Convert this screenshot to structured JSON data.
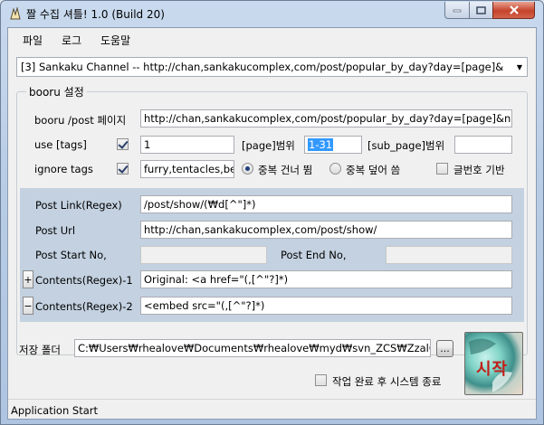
{
  "window": {
    "title": "짤 수집 셔틀! 1.0 (Build 20)"
  },
  "menu": [
    "파일",
    "로그",
    "도움말"
  ],
  "channel_select": {
    "value": "[3] Sankaku Channel -- http://chan,sankakucomplex,com/post/popular_by_day?day=[page]&"
  },
  "booru": {
    "group_label": "booru 설정",
    "post_page_label": "booru /post 페이지",
    "post_page_value": "http://chan,sankakucomplex,com/post/popular_by_day?day=[page]&n",
    "use_tags_label": "use [tags]",
    "use_tags_checked": true,
    "tags_value": "1",
    "page_range_label": "[page]범위",
    "page_range_value": "1-31",
    "sub_page_label": "[sub_page]범위",
    "sub_page_value": "",
    "ignore_tags_label": "ignore tags",
    "ignore_tags_checked": true,
    "ignore_tags_value": "furry,tentacles,be",
    "radio_skip_label": "중복 건너 뜀",
    "radio_overwrite_label": "중복 덮어 씀",
    "radio_selected": "skip",
    "by_post_number_label": "글번호 기반",
    "by_post_number_checked": false
  },
  "regex": {
    "post_link_label": "Post Link(Regex)",
    "post_link_value": "/post/show/(₩d[^\"]*)",
    "post_url_label": "Post Url",
    "post_url_value": "http://chan,sankakucomplex,com/post/show/",
    "post_start_label": "Post Start No,",
    "post_start_value": "",
    "post_end_label": "Post End No,",
    "post_end_value": "",
    "contents1_button": "+",
    "contents1_label": "Contents(Regex)-1",
    "contents1_value": "Original: <a href=\"(,[^\"?]*)",
    "contents2_button": "−",
    "contents2_label": "Contents(Regex)-2",
    "contents2_value": "<embed src=\"(,[^\"?]*)"
  },
  "save": {
    "label": "저장 폴더",
    "path": "C:₩Users₩rhealove₩Documents₩rhealove₩myd₩svn_ZCS₩ZzalC",
    "browse_label": "...",
    "shutdown_label": "작업 완료 후 시스템 종료",
    "shutdown_checked": false,
    "start_label": "시작"
  },
  "status": {
    "text": "Application Start"
  }
}
